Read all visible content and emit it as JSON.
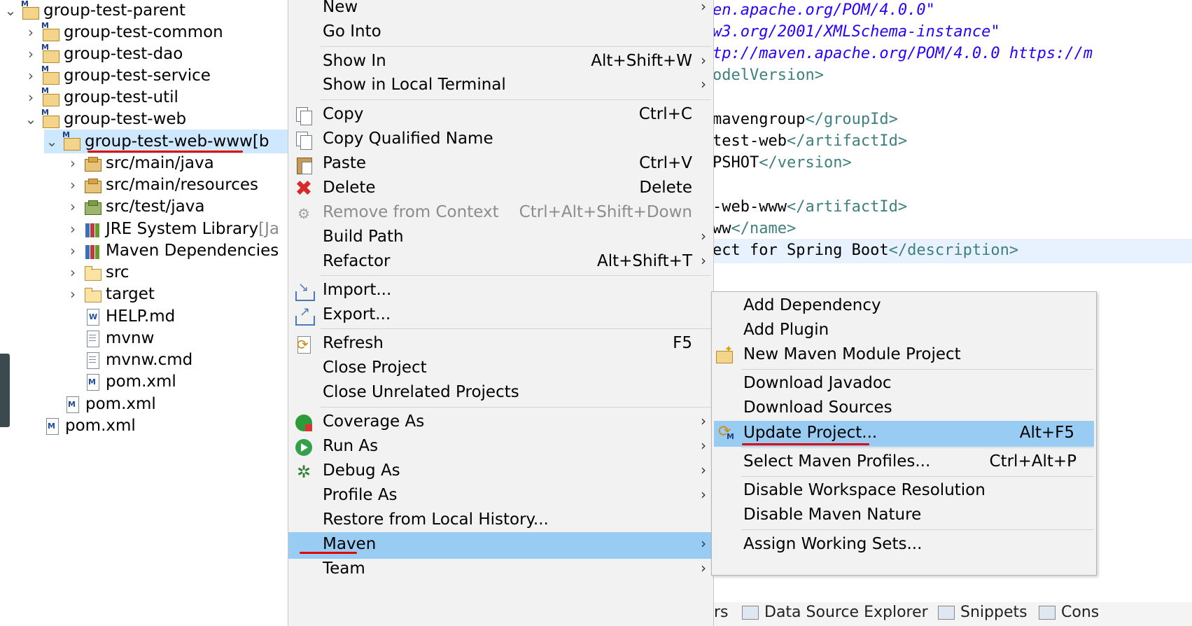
{
  "tree": {
    "items": [
      {
        "chevron": "⌄",
        "label": "group-test-parent",
        "suffix": "",
        "icon": "maven-project-icon"
      },
      {
        "chevron": "›",
        "label": "group-test-common",
        "suffix": "",
        "icon": "maven-project-icon"
      },
      {
        "chevron": "›",
        "label": "group-test-dao",
        "suffix": "",
        "icon": "maven-project-icon"
      },
      {
        "chevron": "›",
        "label": "group-test-service",
        "suffix": "",
        "icon": "maven-project-icon"
      },
      {
        "chevron": "›",
        "label": "group-test-util",
        "suffix": "",
        "icon": "maven-project-icon"
      },
      {
        "chevron": "⌄",
        "label": "group-test-web",
        "suffix": "",
        "icon": "maven-project-icon"
      },
      {
        "chevron": "⌄",
        "label": "group-test-web-www",
        "suffix": " [b",
        "icon": "maven-project-icon"
      },
      {
        "chevron": "›",
        "label": "src/main/java",
        "suffix": "",
        "icon": "source-folder-icon"
      },
      {
        "chevron": "›",
        "label": "src/main/resources",
        "suffix": "",
        "icon": "source-folder-icon"
      },
      {
        "chevron": "›",
        "label": "src/test/java",
        "suffix": "",
        "icon": "test-source-folder-icon"
      },
      {
        "chevron": "›",
        "label": "JRE System Library",
        "suffix": " [Ja",
        "icon": "library-icon"
      },
      {
        "chevron": "›",
        "label": "Maven Dependencies",
        "suffix": "",
        "icon": "library-icon"
      },
      {
        "chevron": "›",
        "label": "src",
        "suffix": "",
        "icon": "folder-icon"
      },
      {
        "chevron": "›",
        "label": "target",
        "suffix": "",
        "icon": "folder-icon"
      },
      {
        "chevron": "",
        "label": "HELP.md",
        "suffix": "",
        "icon": "markdown-file-icon"
      },
      {
        "chevron": "",
        "label": "mvnw",
        "suffix": "",
        "icon": "text-file-icon"
      },
      {
        "chevron": "",
        "label": "mvnw.cmd",
        "suffix": "",
        "icon": "cmd-file-icon"
      },
      {
        "chevron": "",
        "label": "pom.xml",
        "suffix": "",
        "icon": "maven-pom-icon"
      },
      {
        "chevron": "",
        "label": "pom.xml",
        "suffix": "",
        "icon": "maven-pom-icon"
      },
      {
        "chevron": "",
        "label": "pom.xml",
        "suffix": "",
        "icon": "maven-pom-icon"
      }
    ]
  },
  "editor": {
    "lines": [
      {
        "parts": [
          {
            "t": "en.apache.org/POM/4.0.0\"",
            "c": "str"
          }
        ]
      },
      {
        "parts": [
          {
            "t": "w3.org/2001/XMLSchema-instance\"",
            "c": "str"
          }
        ]
      },
      {
        "parts": [
          {
            "t": "tp://maven.apache.org/POM/4.0.0 https://m",
            "c": "str"
          }
        ]
      },
      {
        "parts": [
          {
            "t": "odelVersion>",
            "c": "tag"
          }
        ]
      },
      {
        "parts": [
          {
            "t": "mavengroup",
            "c": "txt"
          },
          {
            "t": "</groupId>",
            "c": "tag"
          }
        ]
      },
      {
        "parts": [
          {
            "t": "test-web",
            "c": "txt"
          },
          {
            "t": "</artifactId>",
            "c": "tag"
          }
        ]
      },
      {
        "parts": [
          {
            "t": "PSHOT",
            "c": "txt"
          },
          {
            "t": "</version>",
            "c": "tag"
          }
        ]
      },
      {
        "parts": [
          {
            "t": "-web-www",
            "c": "txt"
          },
          {
            "t": "</artifactId>",
            "c": "tag"
          }
        ]
      },
      {
        "parts": [
          {
            "t": "ww",
            "c": "txt"
          },
          {
            "t": "</name>",
            "c": "tag"
          }
        ]
      },
      {
        "parts": [
          {
            "t": "ect for Spring Boot",
            "c": "txt"
          },
          {
            "t": "</description>",
            "c": "tag"
          }
        ]
      }
    ],
    "bottom_tabs": [
      "rs",
      "Data Source Explorer",
      "Snippets",
      "Cons"
    ]
  },
  "context_menu": {
    "items": [
      {
        "label": "New",
        "shortcut": "",
        "arrow": true
      },
      {
        "label": "Go Into",
        "shortcut": "",
        "arrow": false
      },
      {
        "label": "Show In",
        "shortcut": "Alt+Shift+W",
        "arrow": true
      },
      {
        "label": "Show in Local Terminal",
        "shortcut": "",
        "arrow": true
      },
      {
        "label": "Copy",
        "shortcut": "Ctrl+C",
        "arrow": false,
        "icon": "copy-icon"
      },
      {
        "label": "Copy Qualified Name",
        "shortcut": "",
        "arrow": false,
        "icon": "copy-qualified-icon"
      },
      {
        "label": "Paste",
        "shortcut": "Ctrl+V",
        "arrow": false,
        "icon": "paste-icon"
      },
      {
        "label": "Delete",
        "shortcut": "Delete",
        "arrow": false,
        "icon": "delete-icon"
      },
      {
        "label": "Remove from Context",
        "shortcut": "Ctrl+Alt+Shift+Down",
        "arrow": false,
        "disabled": true,
        "icon": "remove-context-icon"
      },
      {
        "label": "Build Path",
        "shortcut": "",
        "arrow": true
      },
      {
        "label": "Refactor",
        "shortcut": "Alt+Shift+T",
        "arrow": true
      },
      {
        "label": "Import...",
        "shortcut": "",
        "arrow": false,
        "icon": "import-icon"
      },
      {
        "label": "Export...",
        "shortcut": "",
        "arrow": false,
        "icon": "export-icon"
      },
      {
        "label": "Refresh",
        "shortcut": "F5",
        "arrow": false,
        "icon": "refresh-icon"
      },
      {
        "label": "Close Project",
        "shortcut": "",
        "arrow": false
      },
      {
        "label": "Close Unrelated Projects",
        "shortcut": "",
        "arrow": false
      },
      {
        "label": "Coverage As",
        "shortcut": "",
        "arrow": true,
        "icon": "coverage-icon"
      },
      {
        "label": "Run As",
        "shortcut": "",
        "arrow": true,
        "icon": "run-icon"
      },
      {
        "label": "Debug As",
        "shortcut": "",
        "arrow": true,
        "icon": "debug-icon"
      },
      {
        "label": "Profile As",
        "shortcut": "",
        "arrow": true
      },
      {
        "label": "Restore from Local History...",
        "shortcut": "",
        "arrow": false
      },
      {
        "label": "Maven",
        "shortcut": "",
        "arrow": true,
        "highlighted": true
      },
      {
        "label": "Team",
        "shortcut": "",
        "arrow": true
      }
    ],
    "arrow_glyph": "›"
  },
  "maven_submenu": {
    "items": [
      {
        "label": "Add Dependency",
        "shortcut": ""
      },
      {
        "label": "Add Plugin",
        "shortcut": ""
      },
      {
        "label": "New Maven Module Project",
        "shortcut": "",
        "icon": "new-maven-module-icon"
      },
      {
        "label": "Download Javadoc",
        "shortcut": ""
      },
      {
        "label": "Download Sources",
        "shortcut": ""
      },
      {
        "label": "Update Project...",
        "shortcut": "Alt+F5",
        "highlighted": true,
        "icon": "update-project-icon"
      },
      {
        "label": "Select Maven Profiles...",
        "shortcut": "Ctrl+Alt+P"
      },
      {
        "label": "Disable Workspace Resolution",
        "shortcut": ""
      },
      {
        "label": "Disable Maven Nature",
        "shortcut": ""
      },
      {
        "label": "Assign Working Sets...",
        "shortcut": ""
      }
    ]
  },
  "colors": {
    "menu_bg": "#f2f2f2",
    "menu_highlight": "#99ccf2",
    "tree_selection": "#cde8ff",
    "annotation_underline": "#e00000",
    "xml_string": "#2a00ff",
    "xml_tag": "#3f7f7f"
  }
}
